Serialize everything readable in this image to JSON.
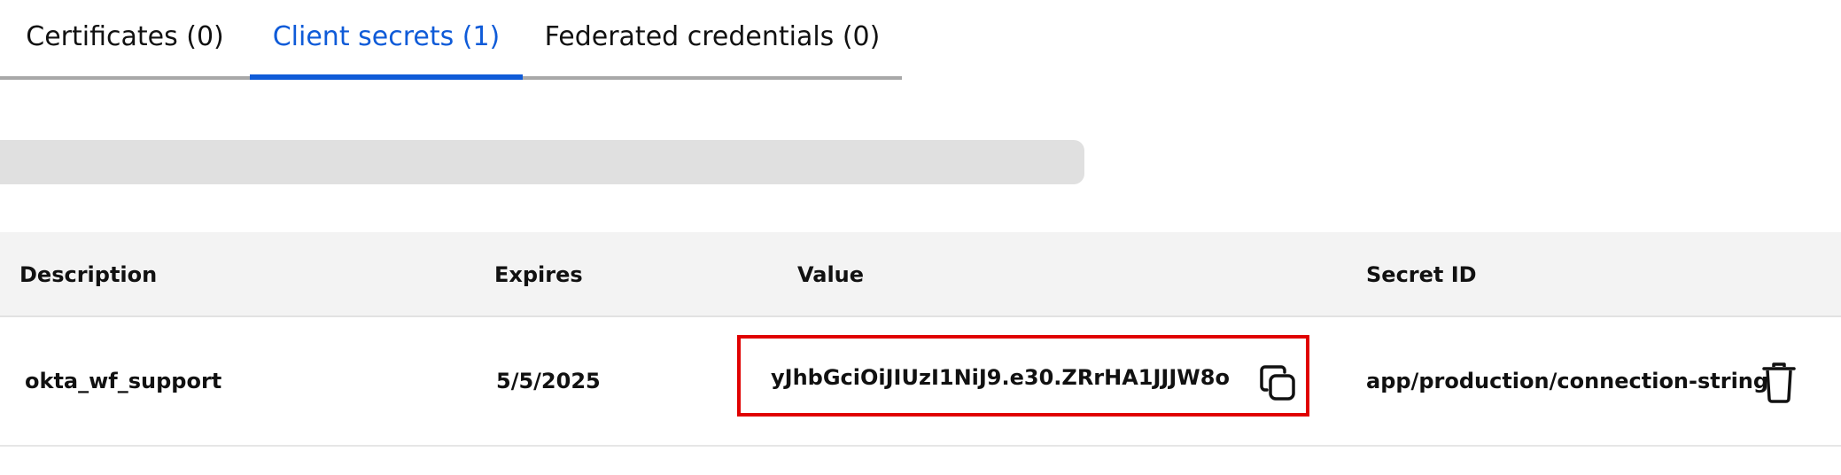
{
  "tabs": [
    {
      "label": "Certificates (0)",
      "active": false
    },
    {
      "label": "Client secrets (1)",
      "active": true
    },
    {
      "label": "Federated credentials (0)",
      "active": false
    }
  ],
  "colors": {
    "active_tab": "#0f5bd8",
    "highlight_border": "#e00000",
    "header_bg": "#f3f3f3"
  },
  "table": {
    "columns": [
      "Description",
      "Expires",
      "Value",
      "Secret ID"
    ],
    "rows": [
      {
        "description": "okta_wf_support",
        "expires": "5/5/2025",
        "value": "yJhbGciOiJIUzI1NiJ9.e30.ZRrHA1JJJW8o",
        "secret_id": "app/production/connection-string"
      }
    ]
  },
  "icons": {
    "copy": "copy-icon",
    "delete": "trash-icon"
  }
}
